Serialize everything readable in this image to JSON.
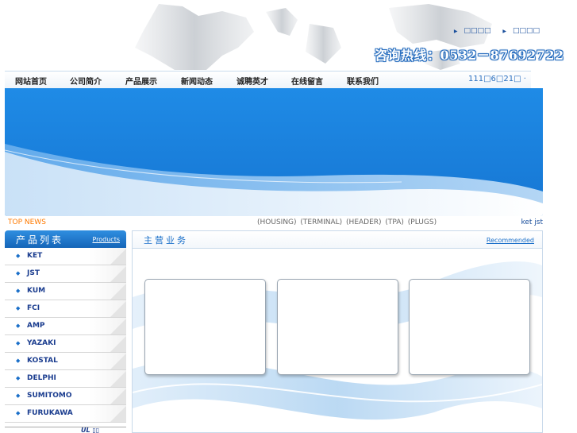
{
  "header": {
    "top_links": [
      "□□□□",
      "□□□□"
    ],
    "hotline": "咨询热线：0532－87692722"
  },
  "nav": {
    "items": [
      "网站首页",
      "公司简介",
      "产品展示",
      "新闻动态",
      "诚聘英才",
      "在线留言",
      "联系我们"
    ],
    "date": "111□6□21□ ·"
  },
  "newsbar": {
    "label": "TOP NEWS",
    "categories": "(HOUSING)  (TERMINAL)  (HEADER)  (TPA)  (PLUGS)",
    "keywords": "ket jst"
  },
  "sidebar": {
    "title": "产品列表",
    "subtitle": "Products",
    "items": [
      "KET",
      "JST",
      "KUM",
      "FCI",
      "AMP",
      "YAZAKI",
      "KOSTAL",
      "DELPHI",
      "SUMITOMO",
      "FURUKAWA"
    ],
    "bottom_logo": "UL ▯▯"
  },
  "main": {
    "title": "主营业务",
    "subtitle": "Recommended"
  },
  "colors": {
    "brand_blue": "#1a6fc9",
    "accent_orange": "#ff7a00"
  }
}
